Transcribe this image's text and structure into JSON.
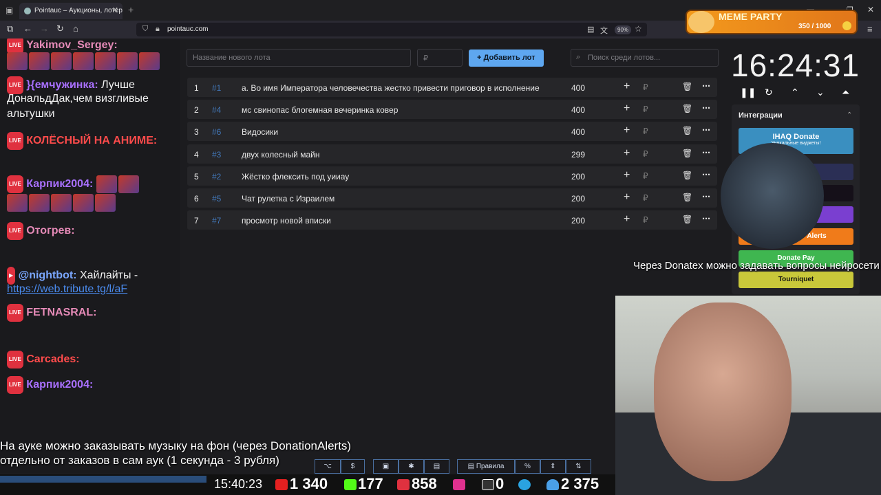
{
  "browser": {
    "tab_title": "Pointauc – Аукционы, лотереи",
    "url": "pointauc.com",
    "zoom": "90%"
  },
  "chat": [
    {
      "user": "Yakimov_Sergey:",
      "msg": ""
    },
    {
      "user": "}{емчужинка:",
      "msg": "Лучше"
    },
    {
      "user": "",
      "msg": "ДональдДак,чем визгливые"
    },
    {
      "user": "",
      "msg": "альтушки"
    },
    {
      "user": "КОЛЁСНЫЙ НА АНИМЕ:",
      "msg": ""
    },
    {
      "user": "Карпик2004:",
      "msg": ""
    },
    {
      "user": "Отогрев:",
      "msg": ""
    },
    {
      "user": "@nightbot:",
      "msg": "Хайлайты -"
    },
    {
      "user": "",
      "msg": "https://web.tribute.tg/l/aF"
    },
    {
      "user": "FETNASRAL:",
      "msg": ""
    },
    {
      "user": "Carcades:",
      "msg": ""
    },
    {
      "user": "Карпик2004:",
      "msg": ""
    }
  ],
  "auction": {
    "new_lot_placeholder": "Название нового лота",
    "currency": "₽",
    "add_label": "Добавить лот",
    "search_placeholder": "Поиск среди лотов...",
    "lots": [
      {
        "n": "1",
        "id": "#1",
        "title": "а. Во имя Императора человечества жестко привести приговор в исполнение",
        "value": "400"
      },
      {
        "n": "2",
        "id": "#4",
        "title": "мс свинопас блогемная вечеринка ковер",
        "value": "400"
      },
      {
        "n": "3",
        "id": "#6",
        "title": "Видосики",
        "value": "400"
      },
      {
        "n": "4",
        "id": "#3",
        "title": "двух колесный майн",
        "value": "299"
      },
      {
        "n": "5",
        "id": "#2",
        "title": "Жёстко флексить под уииау",
        "value": "200"
      },
      {
        "n": "6",
        "id": "#5",
        "title": "Чат рулетка с Израилем",
        "value": "200"
      },
      {
        "n": "7",
        "id": "#7",
        "title": "просмотр новой вписки",
        "value": "200"
      }
    ]
  },
  "timer": "16:24:31",
  "integrations": {
    "title": "Интеграции",
    "ihaq": "IHAQ Donate",
    "ihaq_sub": "Уникальные виджеты!",
    "alerts": "Alerts",
    "donatepay": "Donate Pay",
    "tourniquet": "Tourniquet",
    "colors": {
      "ihaq": "#3a8fc0",
      "dark1": "#2b2f55",
      "dark2": "#151019",
      "purple": "#7a3fd0",
      "alerts": "#f07b1a",
      "donatepay": "#3fb650",
      "tourniquet": "#c9c83a"
    }
  },
  "banner": {
    "title": "MEME PARTY",
    "count": "350 / 1000"
  },
  "overlay": {
    "donatex": "Через Donatex можно задавать вопросы нейросети",
    "line1": "На ауке можно заказывать музыку на фон (через DonationAlerts)",
    "line2": "отдельно от заказов в сам аук (1 секунда - 3 рубля)"
  },
  "toolbar": {
    "rules": "Правила",
    "percent": "%"
  },
  "streambar": {
    "time": "15:40:23",
    "youtube": "1 340",
    "kick": "177",
    "live": "858",
    "rumble": "0",
    "telegram": "2 375"
  }
}
